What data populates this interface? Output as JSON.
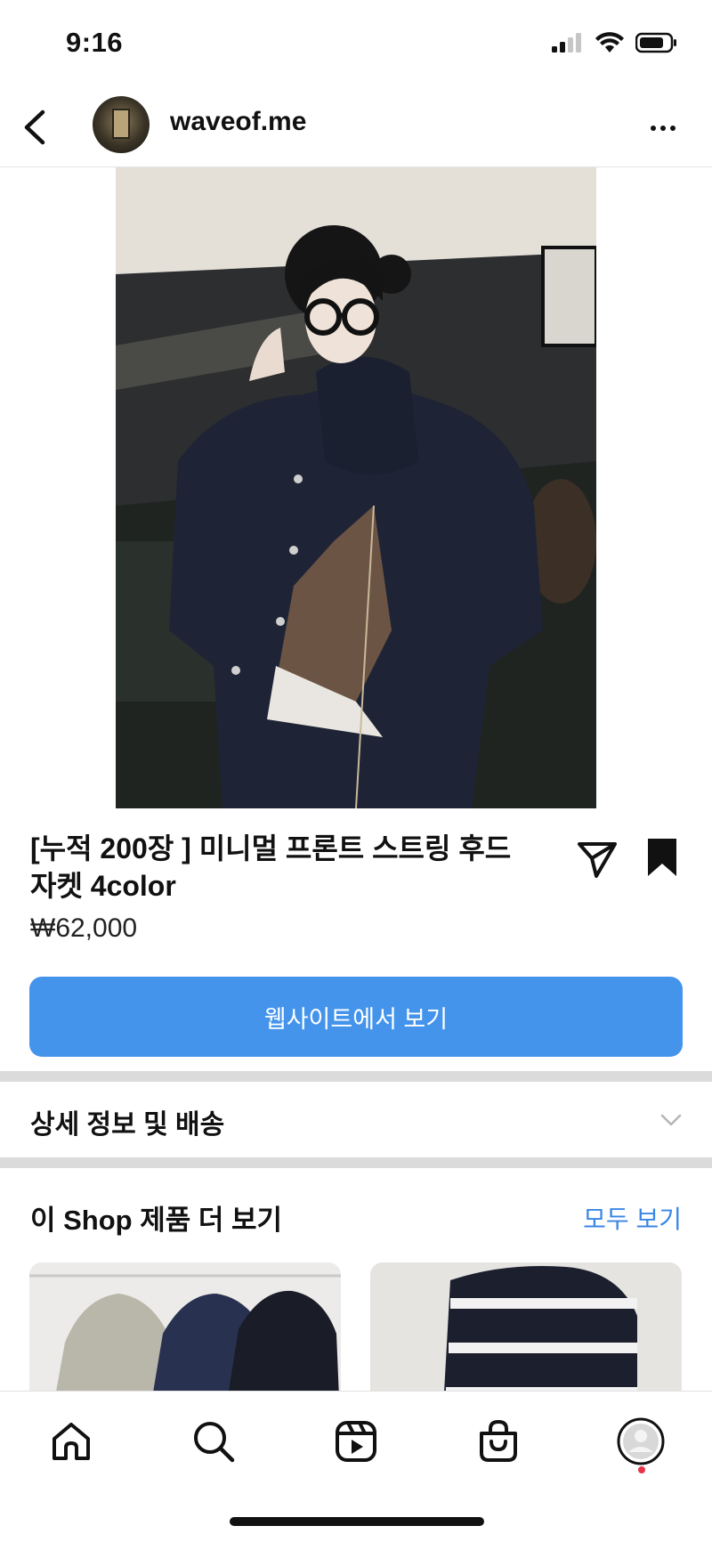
{
  "status_bar": {
    "time": "9:16"
  },
  "header": {
    "username": "waveof.me",
    "back_icon": "chevron-left-icon",
    "more_icon": "more-horizontal-icon"
  },
  "product": {
    "title": "[누적 200장 ] 미니멀 프론트 스트링 후드 자켓 4color",
    "price": "₩62,000",
    "cta_label": "웹사이트에서 보기",
    "cta_color": "#4494ec"
  },
  "details": {
    "label": "상세 정보 및 배송"
  },
  "shop": {
    "title": "이 Shop 제품 더 보기",
    "see_all": "모두 보기",
    "link_color": "#3a86e6"
  },
  "bottom_nav": {
    "items": [
      "home-icon",
      "search-icon",
      "reels-icon",
      "shop-icon",
      "profile-icon"
    ],
    "notification_color": "#e8334a"
  }
}
